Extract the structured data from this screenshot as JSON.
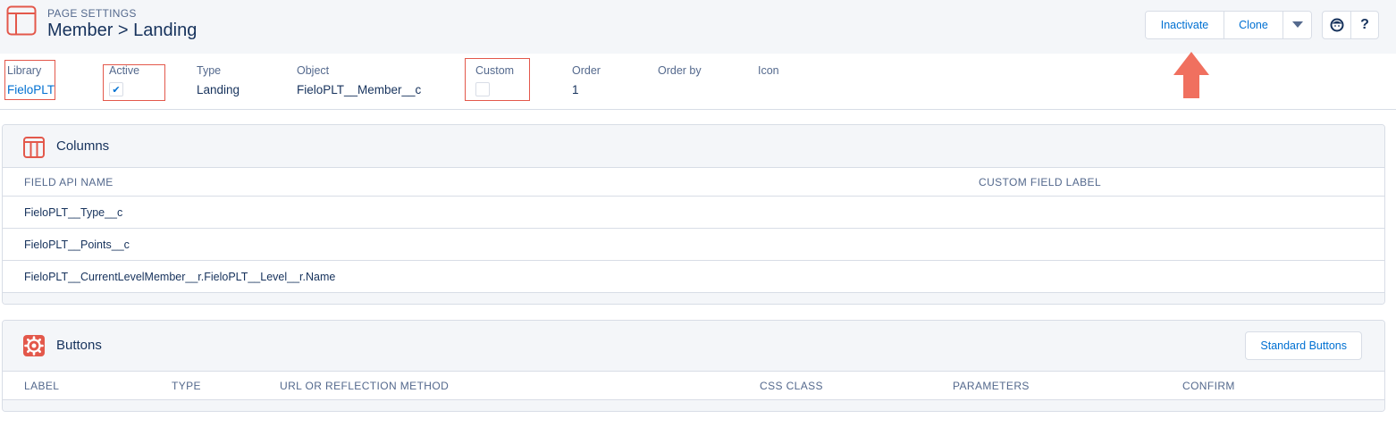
{
  "header": {
    "eyebrow": "PAGE SETTINGS",
    "title": "Member > Landing",
    "buttons": {
      "inactivate": "Inactivate",
      "clone": "Clone",
      "help": "?"
    }
  },
  "fields": {
    "library": {
      "label": "Library",
      "value": "FieloPLT"
    },
    "active": {
      "label": "Active",
      "checked": true
    },
    "type": {
      "label": "Type",
      "value": "Landing"
    },
    "object": {
      "label": "Object",
      "value": "FieloPLT__Member__c"
    },
    "custom": {
      "label": "Custom",
      "checked": false
    },
    "order": {
      "label": "Order",
      "value": "1"
    },
    "order_by": {
      "label": "Order by",
      "value": ""
    },
    "icon": {
      "label": "Icon",
      "value": ""
    }
  },
  "columns_card": {
    "title": "Columns",
    "headers": [
      "FIELD API NAME",
      "CUSTOM FIELD LABEL"
    ],
    "rows": [
      {
        "field_api_name": "FieloPLT__Type__c",
        "custom_field_label": ""
      },
      {
        "field_api_name": "FieloPLT__Points__c",
        "custom_field_label": ""
      },
      {
        "field_api_name": "FieloPLT__CurrentLevelMember__r.FieloPLT__Level__r.Name",
        "custom_field_label": ""
      }
    ]
  },
  "buttons_card": {
    "title": "Buttons",
    "standard_buttons_label": "Standard Buttons",
    "headers": [
      "LABEL",
      "TYPE",
      "URL OR REFLECTION METHOD",
      "CSS CLASS",
      "PARAMETERS",
      "CONFIRM"
    ]
  },
  "colors": {
    "accent_red": "#e3584b",
    "link_blue": "#0070d2",
    "text_dark": "#16325c",
    "text_muted": "#54698d",
    "border": "#d8dde6",
    "header_bg": "#f4f6f9",
    "arrow": "#f0705f"
  }
}
